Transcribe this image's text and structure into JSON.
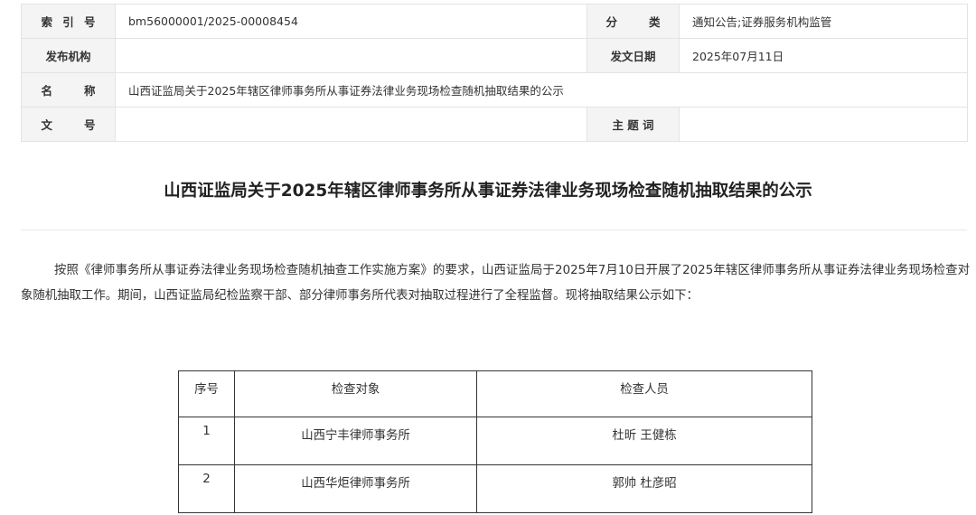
{
  "meta": {
    "index_label": "索 引 号",
    "index_value": "bm56000001/2025-00008454",
    "category_label": "分 类",
    "category_value": "通知公告;证券服务机构监管",
    "issuer_label": "发布机构",
    "issuer_value": "",
    "date_label": "发文日期",
    "date_value": "2025年07月11日",
    "name_label": "名 称",
    "name_value": "山西证监局关于2025年辖区律师事务所从事证券法律业务现场检查随机抽取结果的公示",
    "docno_label": "文 号",
    "docno_value": "",
    "keyword_label": "主 题 词",
    "keyword_value": ""
  },
  "article": {
    "title": "山西证监局关于2025年辖区律师事务所从事证券法律业务现场检查随机抽取结果的公示",
    "paragraph": "按照《律师事务所从事证券法律业务现场检查随机抽查工作实施方案》的要求，山西证监局于2025年7月10日开展了2025年辖区律师事务所从事证券法律业务现场检查对象随机抽取工作。期间，山西证监局纪检监察干部、部分律师事务所代表对抽取过程进行了全程监督。现将抽取结果公示如下："
  },
  "result_table": {
    "headers": [
      "序号",
      "检查对象",
      "检查人员"
    ],
    "rows": [
      [
        "1",
        "山西宁丰律师事务所",
        "杜昕 王健栋"
      ],
      [
        "2",
        "山西华炬律师事务所",
        "郭帅 杜彦昭"
      ]
    ]
  }
}
